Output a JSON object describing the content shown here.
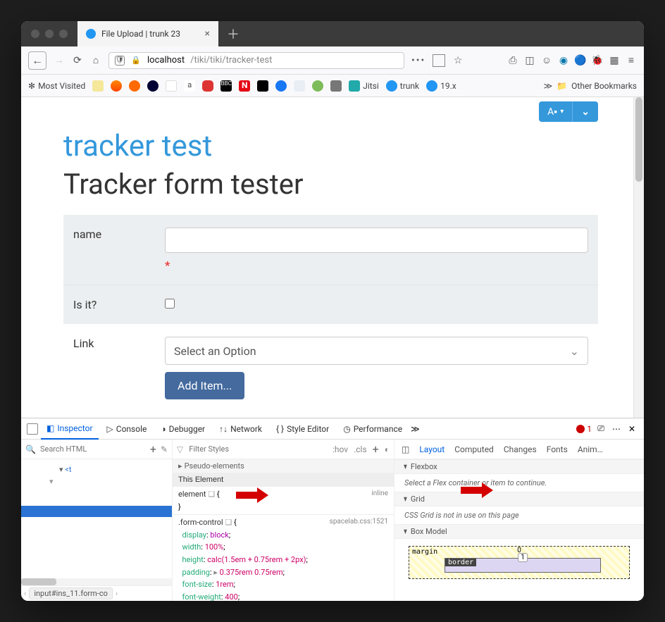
{
  "browser": {
    "tab_title": "File Upload | trunk 23",
    "url_host": "localhost",
    "url_path": "/tiki/tiki/tracker-test",
    "most_visited": "Most Visited",
    "bm_jitsi": "Jitsi",
    "bm_trunk": "trunk",
    "bm_19x": "19.x",
    "other_bookmarks": "Other Bookmarks"
  },
  "page": {
    "link_title": "tracker test",
    "subtitle": "Tracker form tester",
    "name_label": "name",
    "required_mark": "*",
    "isit_label": "Is it?",
    "link_label": "Link",
    "select_placeholder": "Select an Option",
    "add_item_label": "Add Item...",
    "lang_btn": "A•Z"
  },
  "devtools": {
    "tabs": {
      "inspector": "Inspector",
      "console": "Console",
      "debugger": "Debugger",
      "network": "Network",
      "style_editor": "Style Editor",
      "performance": "Performance"
    },
    "error_count": "1",
    "search_html": "Search HTML",
    "filter_styles": "Filter Styles",
    "hov": ":hov",
    "cls": ".cls",
    "side_tabs": {
      "layout": "Layout",
      "computed": "Computed",
      "changes": "Changes",
      "fonts": "Fonts",
      "anim": "Anim…"
    },
    "pseudo": "Pseudo-elements",
    "this_element": "This Element",
    "element_sel": "element",
    "inline": "inline",
    "form_control_sel": ".form-control",
    "css_src": "spacelab.css:1521",
    "decl_display_p": "display",
    "decl_display_v": "block",
    "decl_width_p": "width",
    "decl_width_v": "100%",
    "decl_height_p": "height",
    "decl_height_v": "calc(1.5em + 0.75rem + 2px)",
    "decl_padding_p": "padding",
    "decl_padding_v": "0.375rem 0.75rem",
    "decl_fontsize_p": "font-size",
    "decl_fontsize_v": "1rem",
    "decl_fontweight_p": "font-weight",
    "decl_fontweight_v": "400",
    "flexbox_hdr": "Flexbox",
    "flexbox_msg": "Select a Flex container or item to continue.",
    "grid_hdr": "Grid",
    "grid_msg": "CSS Grid is not in use on this page",
    "boxmodel_hdr": "Box Model",
    "margin_lbl": "margin",
    "border_lbl": "border",
    "margin_top": "0",
    "border_top": "1",
    "breadcrumb": "input#ins_11.form-co",
    "tree_t": "<t"
  }
}
